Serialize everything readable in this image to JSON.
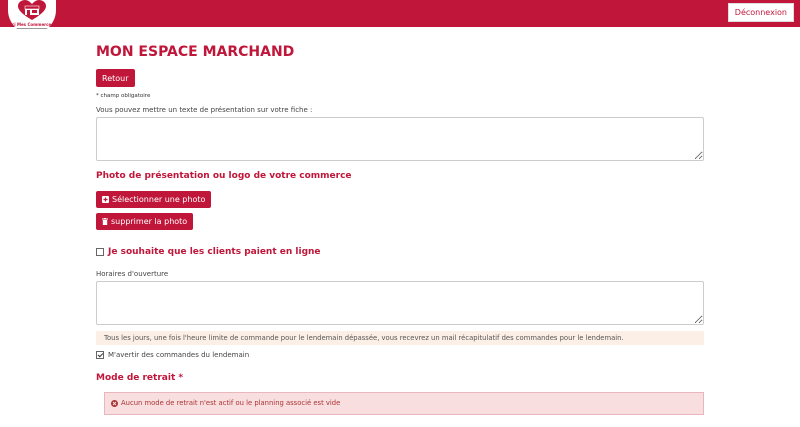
{
  "header": {
    "logo_text": "Ici Mes Commerces",
    "logout_label": "Déconnexion"
  },
  "main": {
    "title": "MON ESPACE MARCHAND",
    "back_label": "Retour",
    "required_note": "* champ obligatoire",
    "presentation_label": "Vous pouvez mettre un texte de présentation sur votre fiche :",
    "photo_section_title": "Photo de présentation ou logo de votre commerce",
    "select_photo_label": "Sélectionner une photo",
    "delete_photo_label": "supprimer la photo",
    "online_payment_label": "Je souhaite que les clients paient en ligne",
    "hours_label": "Horaires d'ouverture",
    "info_text": "Tous les jours, une fois l'heure limite de commande pour le lendemain dépassée, vous recevrez un mail récapitulatif des commandes pour le lendemain.",
    "notify_label": "M'avertir des commandes du lendemain",
    "retrait_title": "Mode de retrait *",
    "alert_text": "Aucun mode de retrait n'est actif ou le planning associé est vide"
  },
  "colors": {
    "brand": "#c0163a",
    "info_bg": "#fcefe6",
    "alert_bg": "#f9dedf"
  },
  "state": {
    "online_payment_checked": false,
    "notify_checked": true
  }
}
